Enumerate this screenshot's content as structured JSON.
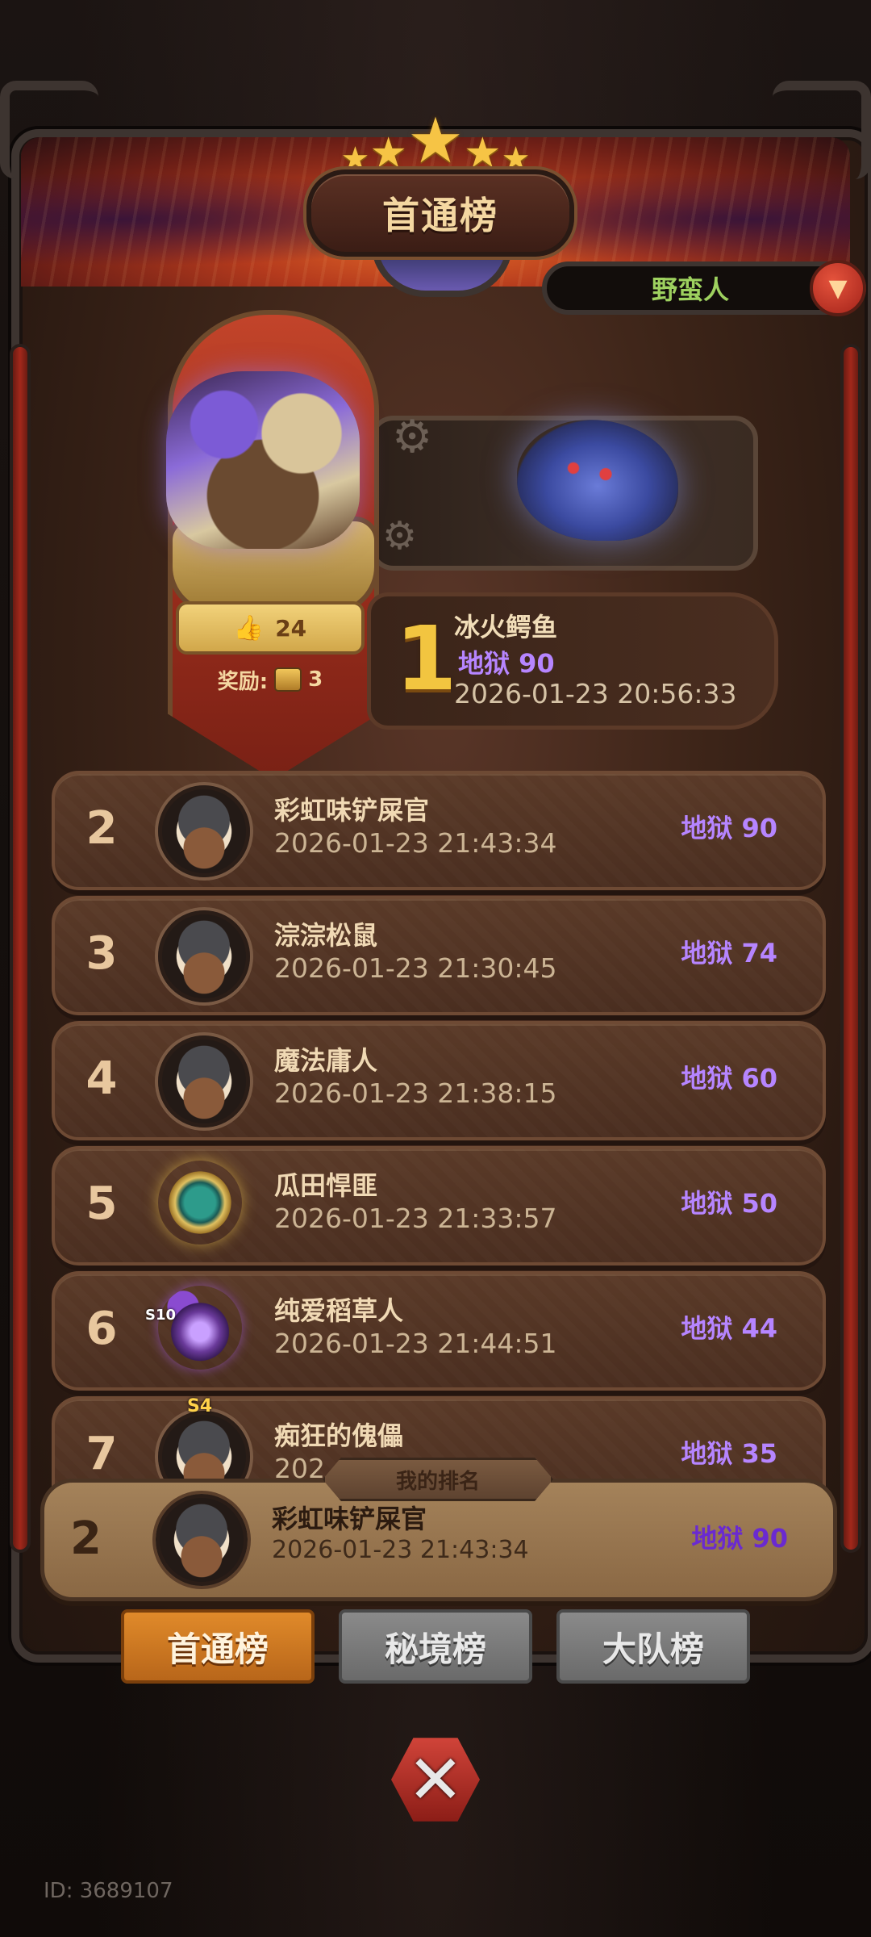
{
  "title": "首通榜",
  "filter": {
    "selected": "野蛮人"
  },
  "first_place": {
    "rank": "1",
    "name": "冰火鳄鱼",
    "level": "地狱 90",
    "time": "2026-01-23 20:56:33",
    "likes": "24",
    "reward_label": "奖励:",
    "reward_count": "3"
  },
  "leaderboard": [
    {
      "rank": "2",
      "name": "彩虹味铲屎官",
      "time": "2026-01-23 21:43:34",
      "level": "地狱 90"
    },
    {
      "rank": "3",
      "name": "淙淙松鼠",
      "time": "2026-01-23 21:30:45",
      "level": "地狱 74"
    },
    {
      "rank": "4",
      "name": "魔法庸人",
      "time": "2026-01-23 21:38:15",
      "level": "地狱 60"
    },
    {
      "rank": "5",
      "name": "瓜田悍匪",
      "time": "2026-01-23 21:33:57",
      "level": "地狱 50"
    },
    {
      "rank": "6",
      "name": "纯爱稻草人",
      "time": "2026-01-23 21:44:51",
      "level": "地狱 44",
      "badge": "S10"
    },
    {
      "rank": "7",
      "name": "痴狂的傀儡",
      "time": "202",
      "level": "地狱 35",
      "badge": "S4"
    }
  ],
  "my_rank": {
    "label": "我的排名",
    "rank": "2",
    "name": "彩虹味铲屎官",
    "time": "2026-01-23 21:43:34",
    "level": "地狱 90"
  },
  "tabs": [
    "首通榜",
    "秘境榜",
    "大队榜"
  ],
  "active_tab": "首通榜",
  "footer_id": "ID: 3689107",
  "colors": {
    "level_text": "#b685ff",
    "filter_text": "#9ed15f",
    "rank_gold": "#f2c540",
    "tab_active": "#e08a2a",
    "tab_inactive": "#7a7a7a"
  }
}
